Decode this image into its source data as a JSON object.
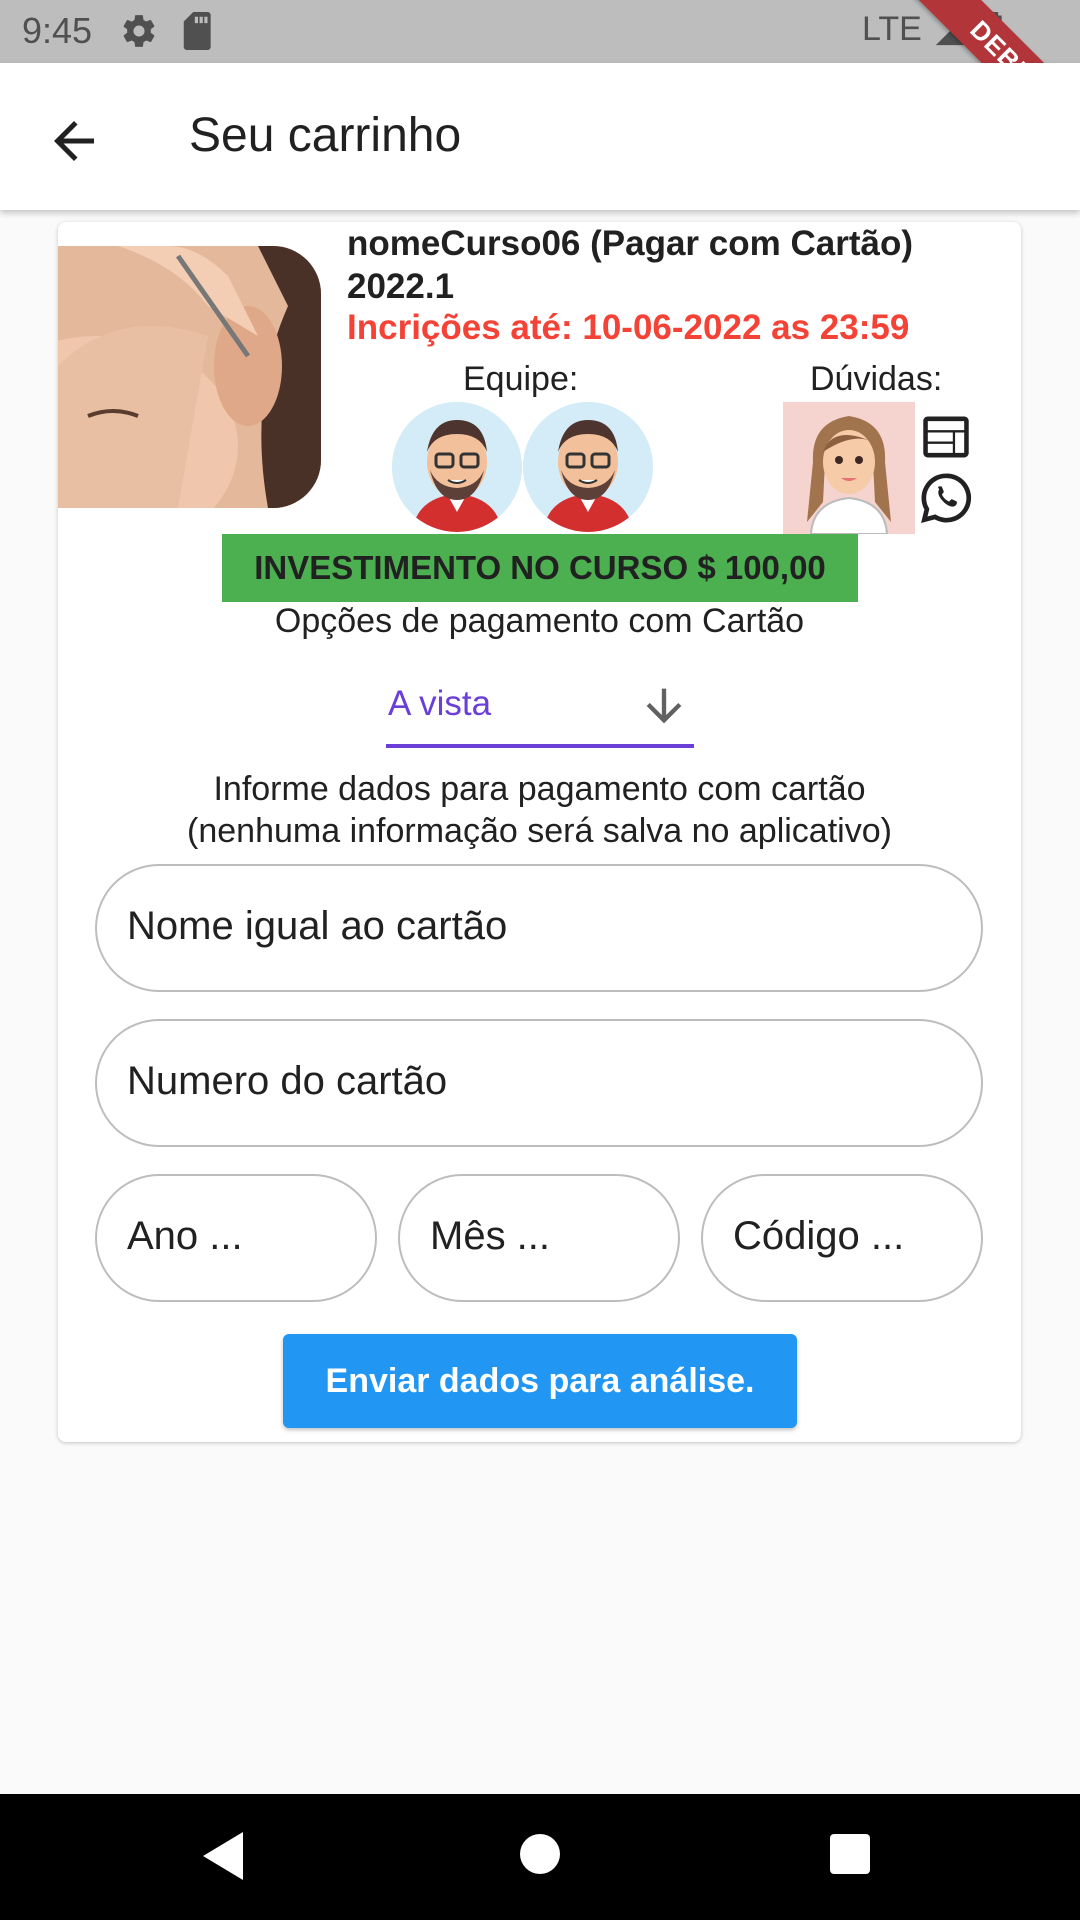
{
  "status_bar": {
    "time": "9:45",
    "network": "LTE",
    "debug_label": "DEBUG"
  },
  "app_bar": {
    "title": "Seu carrinho",
    "back_icon": "arrow-back-icon"
  },
  "course": {
    "name": "nomeCurso06 (Pagar com Cartão) 2022.1",
    "deadline": "Incrições até: 10-06-2022 as 23:59",
    "team_label": "Equipe:",
    "questions_label": "Dúvidas:",
    "team_avatars": [
      "team-member-avatar",
      "team-member-avatar"
    ],
    "contact_icons": [
      "web-icon",
      "whatsapp-icon"
    ]
  },
  "investment": {
    "label": "INVESTIMENTO NO CURSO $ 100,00"
  },
  "payment": {
    "options_label": "Opções de pagamento com Cartão",
    "selected_option": "A vista",
    "info_line_1": "Informe dados para pagamento com cartão",
    "info_line_2": "(nenhuma informação será salva no aplicativo)",
    "fields": {
      "name": "Nome igual ao cartão",
      "number": "Numero do cartão",
      "year": "Ano ...",
      "month": "Mês ...",
      "code": "Código ..."
    },
    "submit_label": "Enviar dados para análise."
  },
  "colors": {
    "accent": "#6a3fd8",
    "deadline": "#f44336",
    "banner": "#4caf50",
    "button": "#2196f3"
  }
}
